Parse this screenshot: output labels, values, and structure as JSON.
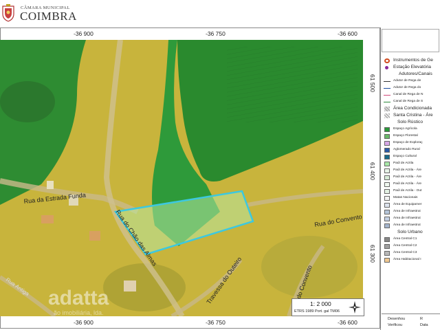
{
  "header": {
    "org_small": "CÂMARA MUNICIPAL",
    "org_big": "COIMBRA"
  },
  "map": {
    "x_ticks_top": [
      "-36 900",
      "-36 750",
      "-36 600"
    ],
    "x_ticks_bottom": [
      "-36 900",
      "-36 750",
      "-36 600"
    ],
    "y_ticks_right": [
      "61 500",
      "61 400",
      "61 300"
    ],
    "streets": {
      "estrada_funda": "Rua da Estrada Funda",
      "chao_almas": "Rua do Chão das Almas",
      "convento_east": "Rua do Convento",
      "outeiro": "Travessa do Outeiro",
      "convento_south": "Rua do Convento",
      "antiga": "Rua Antiga"
    },
    "watermark": "adatta",
    "watermark_sub": "ão imobiliária, lda.",
    "scale": "1: 2 000",
    "projection": "ETRS 1989 Port. gal TM06",
    "colors": {
      "agricultural": "#c8b43c",
      "forest": "#2e9a3a",
      "parcel_outline": "#3cc8e0"
    }
  },
  "legend": {
    "items": [
      {
        "type": "icon",
        "color": "#d04a1e",
        "label": "Instrumentos de Ge",
        "big": true
      },
      {
        "type": "dot",
        "color": "#8a2a9a",
        "label": "Estação Elevatória",
        "big": true
      },
      {
        "type": "head",
        "label": "Adutores/Canais"
      },
      {
        "type": "line",
        "color": "#333333",
        "label": "Adutor de Rega de"
      },
      {
        "type": "line",
        "color": "#1a4aa0",
        "label": "Adutor de Rega do"
      },
      {
        "type": "line",
        "color": "#d0487a",
        "label": "Canal de Rega de N"
      },
      {
        "type": "line",
        "color": "#2a8a3a",
        "label": "Canal de Rega de S"
      },
      {
        "type": "hatch",
        "color": "#dddddd",
        "label": "Área Condicionada",
        "big": true
      },
      {
        "type": "hatch",
        "color": "#eeeeee",
        "label": "Santa Cristina - Áre",
        "big": true
      },
      {
        "type": "head",
        "label": "Solo Rústico",
        "left": true
      },
      {
        "type": "swatch",
        "color": "#2a9a3a",
        "label": "Espaço Agrícola"
      },
      {
        "type": "swatch",
        "color": "#6ab86a",
        "label": "Espaço Florestal"
      },
      {
        "type": "swatch",
        "color": "#d8a8e8",
        "label": "Espaço de Exploraç"
      },
      {
        "type": "swatch",
        "color": "#2a5aa8",
        "label": "Aglomerado Rural"
      },
      {
        "type": "swatch",
        "color": "#1a6a8a",
        "label": "Espaço Cultural"
      },
      {
        "type": "swatch",
        "color": "#a8e8a8",
        "label": "Paúl de Arzila"
      },
      {
        "type": "swatch",
        "color": "#e8f4e8",
        "label": "Paúl de Arzila - Áre"
      },
      {
        "type": "swatch",
        "color": "#d8ecd8",
        "label": "Paúl de Arzila - Áre"
      },
      {
        "type": "swatch",
        "color": "#f0f8f0",
        "label": "Paúl de Arzila - Áre"
      },
      {
        "type": "swatch",
        "color": "#e4f2e4",
        "label": "Paúl de Arzila - Out"
      },
      {
        "type": "swatch",
        "color": "#f4f4f4",
        "label": "Matas Nacionais"
      },
      {
        "type": "swatch",
        "color": "#dde4ee",
        "label": "Área de Equipamer"
      },
      {
        "type": "swatch",
        "color": "#b4c4d8",
        "label": "Área de Infraestrut"
      },
      {
        "type": "swatch",
        "color": "#c4d0e4",
        "label": "Área de Infraestrut"
      },
      {
        "type": "swatch",
        "color": "#a4b4cc",
        "label": "Área de Infraestrut"
      },
      {
        "type": "head",
        "label": "Solo Urbano",
        "left": true
      },
      {
        "type": "swatch",
        "color": "#888888",
        "label": "Área Central C1"
      },
      {
        "type": "swatch",
        "color": "#a0a0a0",
        "label": "Área Central C2"
      },
      {
        "type": "swatch",
        "color": "#b8b8b8",
        "label": "Área Central C3"
      },
      {
        "type": "swatch",
        "color": "#f0c890",
        "label": "Área Habitacional I"
      }
    ]
  },
  "footer": {
    "desenhou": "Desenhou",
    "verificou": "Verificou",
    "val1": "R",
    "val2": "Data"
  }
}
